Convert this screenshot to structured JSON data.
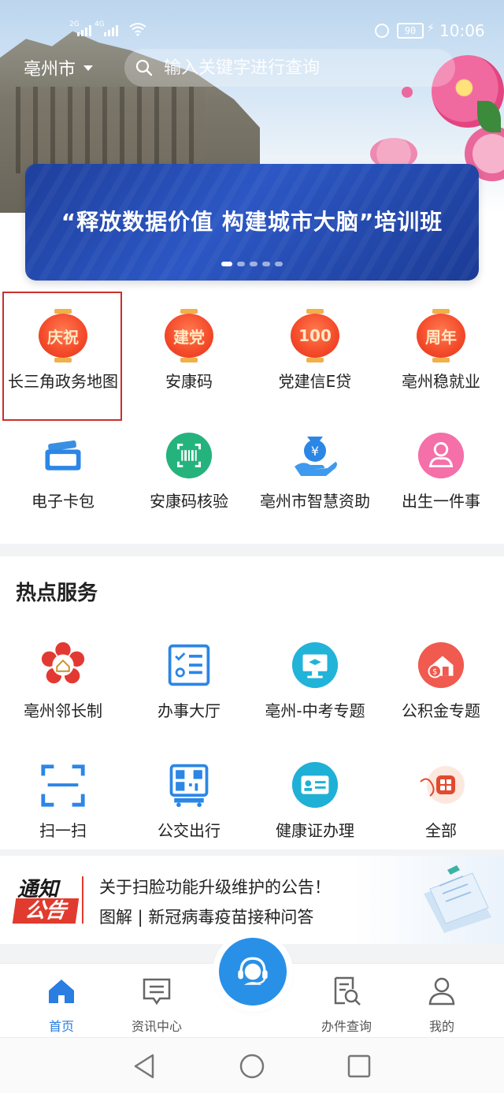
{
  "status_bar": {
    "network_1": "2G",
    "network_2": "4G",
    "battery": "90",
    "time": "10:06"
  },
  "header": {
    "city": "亳州市",
    "search_placeholder": "输入关键字进行查询"
  },
  "banner": {
    "title": "“释放数据价值 构建城市大脑”培训班",
    "slide_count": 5,
    "active_slide": 1
  },
  "top_services": [
    {
      "label": "长三角政务地图",
      "icon": "lantern-icon",
      "glyph": "庆祝"
    },
    {
      "label": "安康码",
      "icon": "lantern-icon",
      "glyph": "建党"
    },
    {
      "label": "党建信E贷",
      "icon": "lantern-icon",
      "glyph": "100"
    },
    {
      "label": "亳州稳就业",
      "icon": "lantern-icon",
      "glyph": "周年"
    },
    {
      "label": "电子卡包",
      "icon": "card-wallet-icon"
    },
    {
      "label": "安康码核验",
      "icon": "barcode-scan-icon"
    },
    {
      "label": "亳州市智慧资助",
      "icon": "hand-yuan-icon"
    },
    {
      "label": "出生一件事",
      "icon": "baby-icon"
    }
  ],
  "hot_services": {
    "title": "热点服务",
    "items": [
      {
        "label": "亳州邻长制",
        "icon": "flower-house-icon"
      },
      {
        "label": "办事大厅",
        "icon": "checklist-icon"
      },
      {
        "label": "亳州-中考专题",
        "icon": "graduation-monitor-icon"
      },
      {
        "label": "公积金专题",
        "icon": "house-dollar-icon"
      },
      {
        "label": "扫一扫",
        "icon": "scan-frame-icon"
      },
      {
        "label": "公交出行",
        "icon": "bus-qr-icon"
      },
      {
        "label": "健康证办理",
        "icon": "id-card-icon"
      },
      {
        "label": "全部",
        "icon": "all-grid-icon"
      }
    ]
  },
  "notice": {
    "logo_line1": "通知",
    "logo_line2": "公告",
    "line1": "关于扫脸功能升级维护的公告！",
    "line2": "图解 | 新冠病毒疫苗接种问答"
  },
  "tabbar": {
    "items": [
      {
        "label": "首页",
        "icon": "home-icon",
        "active": true
      },
      {
        "label": "资讯中心",
        "icon": "message-icon",
        "active": false
      },
      {
        "label": "",
        "icon": "customer-service-icon",
        "active": false
      },
      {
        "label": "办件查询",
        "icon": "doc-search-icon",
        "active": false
      },
      {
        "label": "我的",
        "icon": "user-icon",
        "active": false
      }
    ]
  },
  "colors": {
    "accent": "#2a7de1",
    "center_button": "#2990e8",
    "lantern": "#f44a2a",
    "highlight_border": "#c9302c"
  }
}
